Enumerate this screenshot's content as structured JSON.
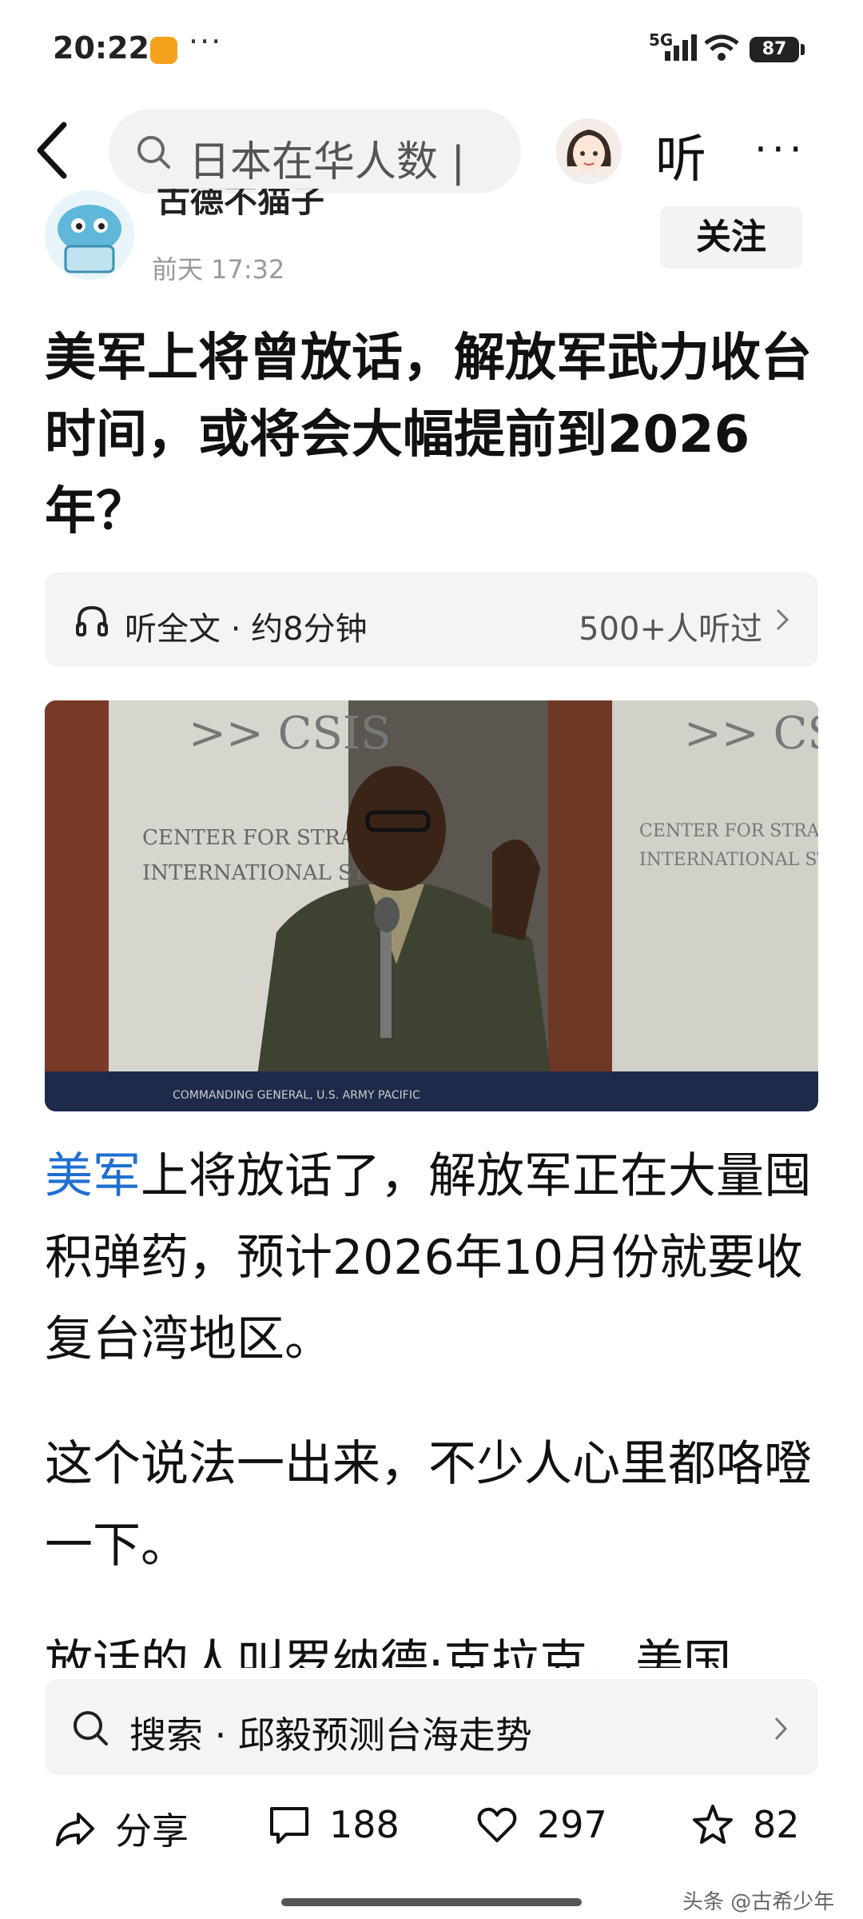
{
  "status_bar": {
    "time": "20:22",
    "more": "···",
    "network": "5G",
    "battery": "87"
  },
  "nav": {
    "search_text": "日本在华人数 |",
    "listen_label": "听",
    "more": "···"
  },
  "author": {
    "name": "古德不猫子",
    "time": "前天 17:32",
    "follow_label": "关注"
  },
  "article": {
    "title": "美军上将曾放话，解放军武力收台时间，或将会大幅提前到2026年？",
    "listen_bar": {
      "left_text": "听全文 · 约8分钟",
      "right_text": "500+人听过"
    },
    "image": {
      "sign_left": ">> CSIS",
      "sign_left_line1": "CENTER FOR STRATE",
      "sign_left_line2": "INTERNATIONAL ST",
      "sign_right": ">> CSIS",
      "sign_right_line1": "CENTER FOR STRATEGIC",
      "sign_right_line2": "INTERNATIONAL STUDIES",
      "caption": "COMMANDING GENERAL, U.S. ARMY PACIFIC"
    },
    "para1_link": "美军",
    "para1_rest": "上将放话了，解放军正在大量囤积弹药，预计2026年10月份就要收复台湾地区。",
    "para2": "这个说法一出来，不少人心里都咯噔一下。",
    "para3": "放话的人叫罗纳德·克拉克，美国"
  },
  "bottom_search": {
    "label": "搜索 · 邱毅预测台海走势"
  },
  "actions": {
    "share": "分享",
    "comments": "188",
    "likes": "297",
    "favorites": "82"
  },
  "watermark": "头条 @古希少年"
}
